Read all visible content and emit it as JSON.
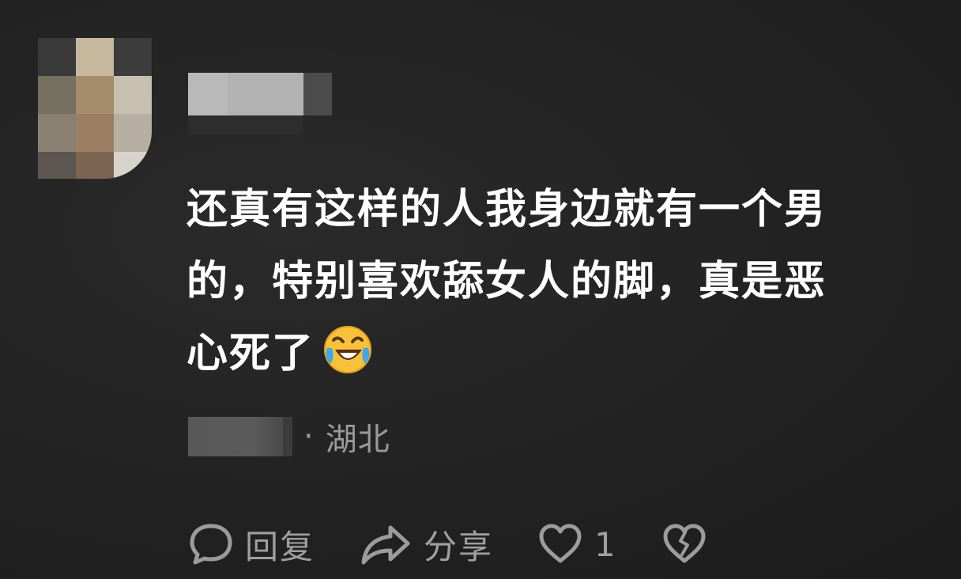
{
  "comment": {
    "text": "还真有这样的人我身边就有一个男的，特别喜欢舔女人的脚，真是恶心死了",
    "line1": "还真有这样的人我身边就有一个男",
    "line2": "的，特别喜欢舔女人的脚，真是恶",
    "line3": "心死了",
    "emoji": "laughing-crying-emoji"
  },
  "meta": {
    "separator": "·",
    "location": "湖北"
  },
  "actions": {
    "reply_label": "回复",
    "share_label": "分享",
    "like_count": "1"
  },
  "icons": {
    "reply": "speech-bubble-icon",
    "share": "share-arrow-icon",
    "like": "heart-icon",
    "dislike": "broken-heart-icon"
  },
  "colors": {
    "background": "#232323",
    "text": "#ffffff",
    "secondary": "#9a9a9a"
  }
}
